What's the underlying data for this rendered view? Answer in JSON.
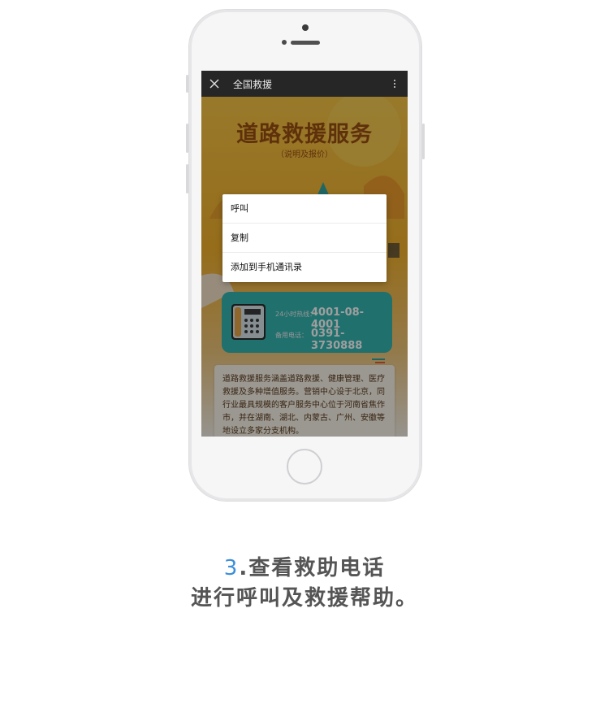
{
  "screen": {
    "title": "全国救援",
    "headline": "道路救援服务",
    "subheadline": "（说明及报价）",
    "hotline_label": "24小时热线：",
    "hotline_number": "4001-08-4001",
    "backup_label": "备用电话：",
    "backup_number": "0391-3730888",
    "intro_text": "道路救援服务涵盖道路救援、健康管理、医疗救援及多种增值服务。营销中心设于北京，同行业最具规模的客户服务中心位于河南省焦作市，并在湖南、湖北、内蒙古、广州、安徽等地设立多家分支机构。"
  },
  "context_menu": {
    "items": [
      "呼叫",
      "复制",
      "添加到手机通讯录"
    ]
  },
  "caption": {
    "step_number": "3",
    "line1_text": ".查看救助电话",
    "line2_text": "进行呼叫及救援帮助。"
  },
  "colors": {
    "accent": "#3b8fd9",
    "caption_text": "#555555",
    "topbar": "#262626",
    "poster_orange": "#f2b12e",
    "card_teal": "#34b5b0"
  },
  "icons": [
    "close-icon",
    "more-vert-icon",
    "telephone-icon"
  ]
}
